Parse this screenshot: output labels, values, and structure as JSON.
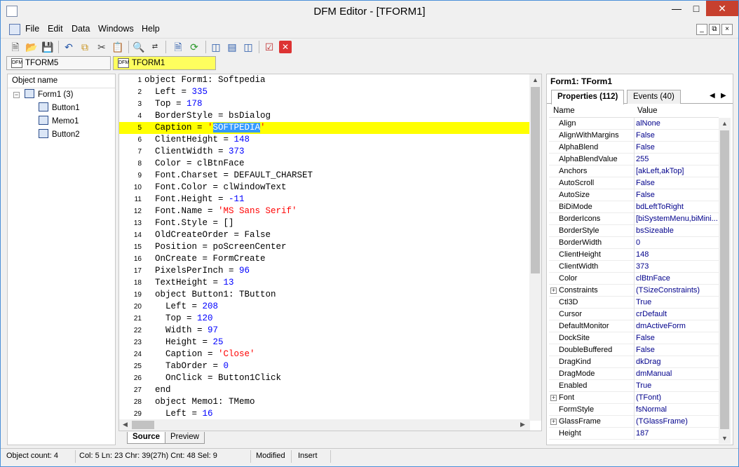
{
  "window": {
    "title": "DFM Editor - [TFORM1]"
  },
  "menu": [
    "File",
    "Edit",
    "Data",
    "Windows",
    "Help"
  ],
  "toolbar": {
    "buttons": [
      "new-icon",
      "open-icon",
      "save-icon",
      "undo-icon",
      "copy-icon",
      "cut-icon",
      "paste-icon",
      "find-icon",
      "replace-icon",
      "preview-icon",
      "refresh-icon",
      "cascade-icon",
      "tile-horizontal-icon",
      "tile-vertical-icon",
      "check-icon",
      "close-doc-icon"
    ]
  },
  "doc_tabs": [
    "TFORM5",
    "TFORM1"
  ],
  "object_tree": {
    "header": "Object name",
    "root": "Form1 (3)",
    "children": [
      "Button1",
      "Memo1",
      "Button2"
    ]
  },
  "editor": {
    "lines": [
      {
        "n": "1",
        "parts": [
          [
            "object Form1: Softpedia",
            "t"
          ]
        ]
      },
      {
        "n": "2",
        "parts": [
          [
            "  Left = ",
            "t"
          ],
          [
            "335",
            "num"
          ]
        ]
      },
      {
        "n": "3",
        "parts": [
          [
            "  Top = ",
            "t"
          ],
          [
            "178",
            "num"
          ]
        ]
      },
      {
        "n": "4",
        "parts": [
          [
            "  BorderStyle = bsDialog",
            "t"
          ]
        ]
      },
      {
        "n": "5",
        "parts": [
          [
            "  Caption = ",
            "t"
          ],
          [
            "'",
            "str"
          ],
          [
            "SOFTPEDIA",
            "sel"
          ],
          [
            "'",
            "str"
          ]
        ],
        "highlight": true
      },
      {
        "n": "6",
        "parts": [
          [
            "  ClientHeight = ",
            "t"
          ],
          [
            "148",
            "num"
          ]
        ]
      },
      {
        "n": "7",
        "parts": [
          [
            "  ClientWidth = ",
            "t"
          ],
          [
            "373",
            "num"
          ]
        ]
      },
      {
        "n": "8",
        "parts": [
          [
            "  Color = clBtnFace",
            "t"
          ]
        ]
      },
      {
        "n": "9",
        "parts": [
          [
            "  Font.Charset = DEFAULT_CHARSET",
            "t"
          ]
        ]
      },
      {
        "n": "10",
        "parts": [
          [
            "  Font.Color = clWindowText",
            "t"
          ]
        ]
      },
      {
        "n": "11",
        "parts": [
          [
            "  Font.Height = ",
            "t"
          ],
          [
            "-11",
            "num"
          ]
        ]
      },
      {
        "n": "12",
        "parts": [
          [
            "  Font.Name = ",
            "t"
          ],
          [
            "'MS Sans Serif'",
            "str"
          ]
        ]
      },
      {
        "n": "13",
        "parts": [
          [
            "  Font.Style = []",
            "t"
          ]
        ]
      },
      {
        "n": "14",
        "parts": [
          [
            "  OldCreateOrder = False",
            "t"
          ]
        ]
      },
      {
        "n": "15",
        "parts": [
          [
            "  Position = poScreenCenter",
            "t"
          ]
        ]
      },
      {
        "n": "16",
        "parts": [
          [
            "  OnCreate = FormCreate",
            "t"
          ]
        ]
      },
      {
        "n": "17",
        "parts": [
          [
            "  PixelsPerInch = ",
            "t"
          ],
          [
            "96",
            "num"
          ]
        ]
      },
      {
        "n": "18",
        "parts": [
          [
            "  TextHeight = ",
            "t"
          ],
          [
            "13",
            "num"
          ]
        ]
      },
      {
        "n": "19",
        "parts": [
          [
            "  object Button1: TButton",
            "t"
          ]
        ]
      },
      {
        "n": "20",
        "parts": [
          [
            "    Left = ",
            "t"
          ],
          [
            "208",
            "num"
          ]
        ]
      },
      {
        "n": "21",
        "parts": [
          [
            "    Top = ",
            "t"
          ],
          [
            "120",
            "num"
          ]
        ]
      },
      {
        "n": "22",
        "parts": [
          [
            "    Width = ",
            "t"
          ],
          [
            "97",
            "num"
          ]
        ]
      },
      {
        "n": "23",
        "parts": [
          [
            "    Height = ",
            "t"
          ],
          [
            "25",
            "num"
          ]
        ]
      },
      {
        "n": "24",
        "parts": [
          [
            "    Caption = ",
            "t"
          ],
          [
            "'Close'",
            "str"
          ]
        ]
      },
      {
        "n": "25",
        "parts": [
          [
            "    TabOrder = ",
            "t"
          ],
          [
            "0",
            "num"
          ]
        ]
      },
      {
        "n": "26",
        "parts": [
          [
            "    OnClick = Button1Click",
            "t"
          ]
        ]
      },
      {
        "n": "27",
        "parts": [
          [
            "  end",
            "t"
          ]
        ]
      },
      {
        "n": "28",
        "parts": [
          [
            "  object Memo1: TMemo",
            "t"
          ]
        ]
      },
      {
        "n": "29",
        "parts": [
          [
            "    Left = ",
            "t"
          ],
          [
            "16",
            "num"
          ]
        ]
      }
    ],
    "tabs": [
      "Source",
      "Preview"
    ]
  },
  "inspector": {
    "title": "Form1: TForm1",
    "tabs": [
      "Properties (112)",
      "Events (40)"
    ],
    "col_name": "Name",
    "col_value": "Value",
    "rows": [
      {
        "name": "Align",
        "value": "alNone"
      },
      {
        "name": "AlignWithMargins",
        "value": "False"
      },
      {
        "name": "AlphaBlend",
        "value": "False"
      },
      {
        "name": "AlphaBlendValue",
        "value": "255"
      },
      {
        "name": "Anchors",
        "value": "[akLeft,akTop]"
      },
      {
        "name": "AutoScroll",
        "value": "False"
      },
      {
        "name": "AutoSize",
        "value": "False"
      },
      {
        "name": "BiDiMode",
        "value": "bdLeftToRight"
      },
      {
        "name": "BorderIcons",
        "value": "[biSystemMenu,biMini..."
      },
      {
        "name": "BorderStyle",
        "value": "bsSizeable"
      },
      {
        "name": "BorderWidth",
        "value": "0"
      },
      {
        "name": "ClientHeight",
        "value": "148"
      },
      {
        "name": "ClientWidth",
        "value": "373"
      },
      {
        "name": "Color",
        "value": "clBtnFace"
      },
      {
        "name": "Constraints",
        "value": "(TSizeConstraints)",
        "expandable": true
      },
      {
        "name": "Ctl3D",
        "value": "True"
      },
      {
        "name": "Cursor",
        "value": "crDefault"
      },
      {
        "name": "DefaultMonitor",
        "value": "dmActiveForm"
      },
      {
        "name": "DockSite",
        "value": "False"
      },
      {
        "name": "DoubleBuffered",
        "value": "False"
      },
      {
        "name": "DragKind",
        "value": "dkDrag"
      },
      {
        "name": "DragMode",
        "value": "dmManual"
      },
      {
        "name": "Enabled",
        "value": "True"
      },
      {
        "name": "Font",
        "value": "(TFont)",
        "expandable": true
      },
      {
        "name": "FormStyle",
        "value": "fsNormal"
      },
      {
        "name": "GlassFrame",
        "value": "(TGlassFrame)",
        "expandable": true
      },
      {
        "name": "Height",
        "value": "187"
      }
    ]
  },
  "status": {
    "object_count": "Object count: 4",
    "position": "Col: 5  Ln: 23  Chr: 39(27h)  Cnt: 48  Sel: 9",
    "modified": "Modified",
    "insert": "Insert"
  },
  "colors": {
    "highlight_line": "#ffff00",
    "selection": "#3399ff",
    "number": "#0000ff",
    "string": "#ff0000",
    "close_button": "#c7402e"
  }
}
